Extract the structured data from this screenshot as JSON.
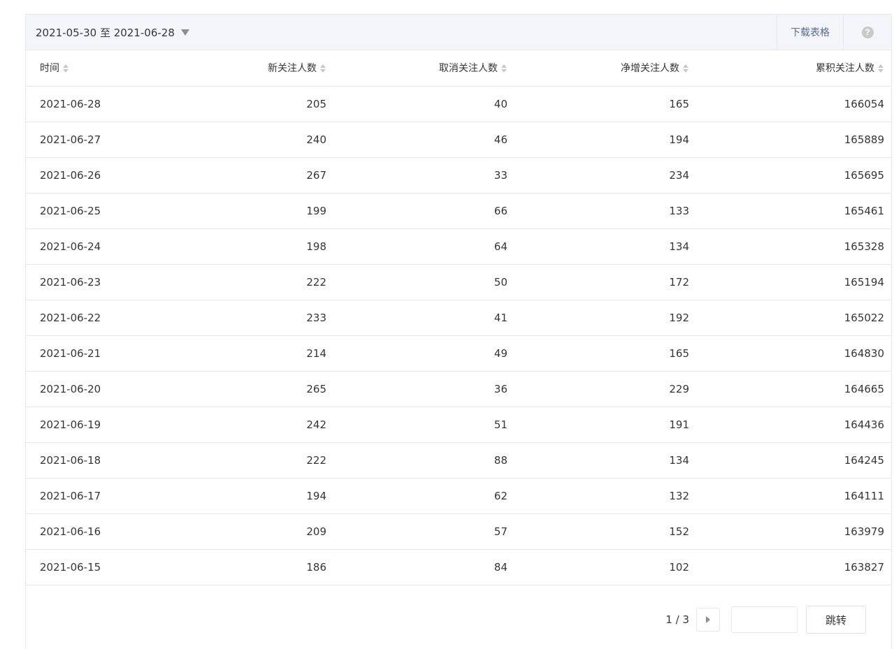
{
  "toolbar": {
    "date_range": "2021-05-30 至 2021-06-28",
    "download_label": "下载表格",
    "help_icon": "?"
  },
  "table": {
    "headers": [
      "时间",
      "新关注人数",
      "取消关注人数",
      "净增关注人数",
      "累积关注人数"
    ],
    "rows": [
      [
        "2021-06-28",
        "205",
        "40",
        "165",
        "166054"
      ],
      [
        "2021-06-27",
        "240",
        "46",
        "194",
        "165889"
      ],
      [
        "2021-06-26",
        "267",
        "33",
        "234",
        "165695"
      ],
      [
        "2021-06-25",
        "199",
        "66",
        "133",
        "165461"
      ],
      [
        "2021-06-24",
        "198",
        "64",
        "134",
        "165328"
      ],
      [
        "2021-06-23",
        "222",
        "50",
        "172",
        "165194"
      ],
      [
        "2021-06-22",
        "233",
        "41",
        "192",
        "165022"
      ],
      [
        "2021-06-21",
        "214",
        "49",
        "165",
        "164830"
      ],
      [
        "2021-06-20",
        "265",
        "36",
        "229",
        "164665"
      ],
      [
        "2021-06-19",
        "242",
        "51",
        "191",
        "164436"
      ],
      [
        "2021-06-18",
        "222",
        "88",
        "134",
        "164245"
      ],
      [
        "2021-06-17",
        "194",
        "62",
        "132",
        "164111"
      ],
      [
        "2021-06-16",
        "209",
        "57",
        "152",
        "163979"
      ],
      [
        "2021-06-15",
        "186",
        "84",
        "102",
        "163827"
      ]
    ]
  },
  "pager": {
    "page_info": "1 / 3",
    "jump_input_value": "",
    "jump_label": "跳转"
  },
  "colors": {
    "header_bg": "#f4f5f9",
    "border": "#e7e7eb",
    "link": "#576b95"
  }
}
